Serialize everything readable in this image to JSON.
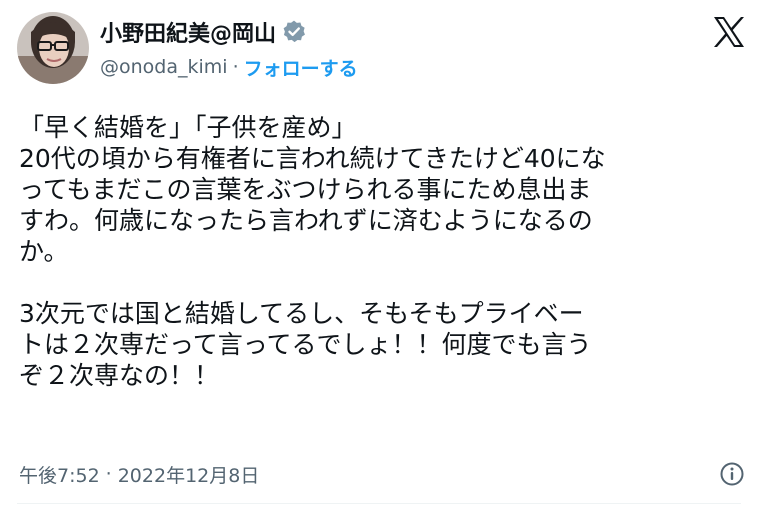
{
  "user": {
    "display_name": "小野田紀美@岡山",
    "handle": "@onoda_kimi",
    "separator": "·",
    "follow_label": "フォローする"
  },
  "icons": {
    "avatar": "user-avatar",
    "verified": "verified-badge-icon",
    "logo": "x-logo-icon",
    "info": "info-icon"
  },
  "tweet": {
    "lines": [
      "「早く結婚を」「子供を産め」",
      "20代の頃から有権者に言われ続けてきたけど40にな",
      "ってもまだこの言葉をぶつけられる事にため息出ま",
      "すわ。何歳になったら言われずに済むようになるの",
      "か。",
      "3次元では国と結婚してるし、そもそもプライベー",
      "トは２次専だって言ってるでしょ！！何度でも言う",
      "ぞ２次専なの！！"
    ]
  },
  "meta": {
    "time": "午後7:52",
    "separator": "·",
    "date": "2022年12月8日"
  },
  "colors": {
    "text": "#0f1419",
    "secondary": "#536471",
    "accent": "#1d9bf0",
    "verified_badge": "#829aab"
  }
}
